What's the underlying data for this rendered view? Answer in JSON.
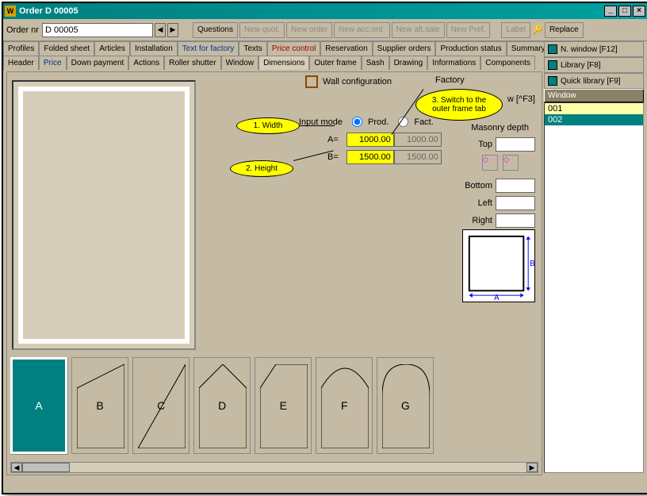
{
  "window": {
    "title": "Order D 00005"
  },
  "toolbar": {
    "order_nr_label": "Order nr",
    "order_nr_value": "D 00005",
    "buttons": {
      "questions": "Questions",
      "new_quot": "New quot.",
      "new_order": "New order",
      "new_acc": "New acc.ord.",
      "new_aft": "New aft.sale",
      "new_pref": "New Pref.",
      "label": "Label",
      "replace": "Replace"
    }
  },
  "tabs_row1": [
    "Profiles",
    "Folded sheet",
    "Articles",
    "Installation",
    "Text for factory",
    "Texts",
    "Price control",
    "Reservation",
    "Supplier orders",
    "Production status",
    "Summary"
  ],
  "tabs_row2": [
    "Header",
    "Price",
    "Down payment",
    "Actions",
    "Roller shutter",
    "Window",
    "Dimensions",
    "Outer frame",
    "Sash",
    "Drawing",
    "Informations",
    "Components"
  ],
  "sidebar": {
    "nwindow": "N. window [F12]",
    "library": "Library [F8]",
    "quicklib": "Quick library [F9]",
    "header": "Window",
    "items": [
      "001",
      "002"
    ]
  },
  "midpane": {
    "wall_config": "Wall configuration",
    "factory": "Factory",
    "new_window": "w [^F3]",
    "input_mode": "Input mode",
    "prod": "Prod.",
    "fact": "Fact.",
    "dim_a_label": "A=",
    "dim_a_value": "1000.00",
    "dim_a_ro": "1000.00",
    "dim_b_label": "B=",
    "dim_b_value": "1500.00",
    "dim_b_ro": "1500.00",
    "masonry_title": "Masonry depth",
    "top": "Top",
    "bottom": "Bottom",
    "left": "Left",
    "right": "Right",
    "diag_a": "A",
    "diag_b": "B"
  },
  "shapes": [
    "A",
    "B",
    "C",
    "D",
    "E",
    "F",
    "G"
  ],
  "callouts": {
    "c1": "1. Width",
    "c2": "2. Height",
    "c3": "3. Switch to the outer frame tab"
  }
}
